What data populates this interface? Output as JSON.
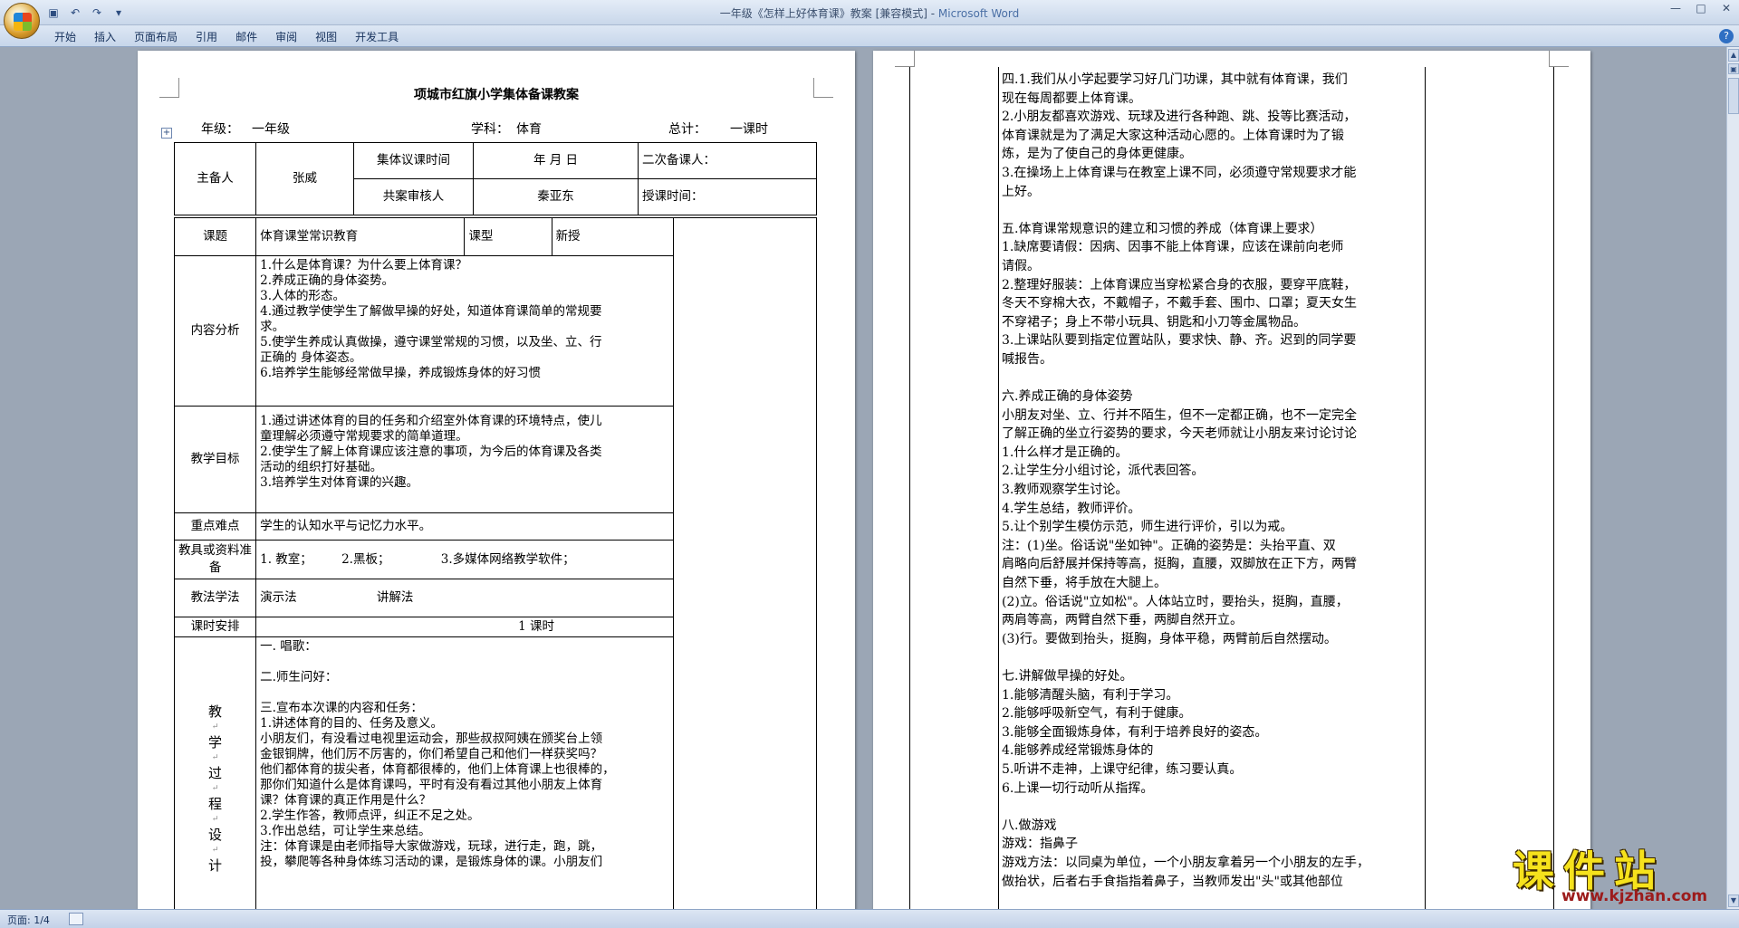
{
  "window": {
    "title": "一年级《怎样上好体育课》教案 [兼容模式] - ",
    "app_name": "Microsoft Word"
  },
  "qat": {
    "save_icon": "save-icon",
    "undo": "↶",
    "redo": "↷",
    "dropdown": "▾"
  },
  "window_controls": {
    "minimize": "—",
    "maximize": "□",
    "close": "✕"
  },
  "ribbon": {
    "tabs": [
      "开始",
      "插入",
      "页面布局",
      "引用",
      "邮件",
      "审阅",
      "视图",
      "开发工具"
    ],
    "help": "?"
  },
  "page1": {
    "title": "项城市红旗小学集体备课教案",
    "grade_label": "年级：",
    "grade": "一年级",
    "subject_label": "学科：",
    "subject": "体育",
    "total_label": "总计：",
    "total": "一课时",
    "table": {
      "host_label": "主备人",
      "host": "张威",
      "meeting_time_label": "集体议课时间",
      "meeting_time": "年    月    日",
      "second_label": "二次备课人：",
      "reviewer_label": "共案审核人",
      "reviewer": "秦亚东",
      "teach_time_label": "授课时间：",
      "topic_label": "课题",
      "topic": "体育课堂常识教育",
      "type_label": "课型",
      "type": "新授",
      "content_label": "内容分析",
      "content": [
        "1.什么是体育课？为什么要上体育课？",
        "2.养成正确的身体姿势。",
        "3.人体的形态。",
        "4.通过教学使学生了解做早操的好处，知道体育课简单的常规要",
        "求。",
        "5.使学生养成认真做操，遵守课堂常规的习惯，以及坐、立、行",
        "正确的 身体姿态。",
        "6.培养学生能够经常做早操，养成锻炼身体的好习惯"
      ],
      "goal_label": "教学目标",
      "goals": [
        "1.通过讲述体育的目的任务和介绍室外体育课的环境特点，使儿",
        "童理解必须遵守常规要求的简单道理。",
        "2.使学生了解上体育课应该注意的事项，为今后的体育课及各类",
        "活动的组织打好基础。",
        "3.培养学生对体育课的兴趣。"
      ],
      "key_label": "重点难点",
      "key": "学生的认知水平与记忆力水平。",
      "tools_label": "教具或资料准备",
      "tools": [
        "1. 教室；",
        "2.黑板；",
        "3.多媒体网络教学软件；"
      ],
      "method_label": "教法学法",
      "methods": [
        "演示法",
        "讲解法"
      ],
      "schedule_label": "课时安排",
      "schedule": "1 课时",
      "process_label": [
        "教",
        "学",
        "过",
        "程",
        "设",
        "计"
      ],
      "process": [
        "一.      唱歌：",
        "",
        "二.师生问好：",
        "",
        "三.宣布本次课的内容和任务：",
        "1.讲述体育的目的、任务及意义。",
        "小朋友们，有没看过电视里运动会，那些叔叔阿姨在颁奖台上领",
        "金银铜牌，他们厉不厉害的，你们希望自己和他们一样获奖吗？",
        "他们都体育的拔尖者，体育都很棒的，他们上体育课上也很棒的，",
        "那你们知道什么是体育课吗，平时有没有看过其他小朋友上体育",
        "课？体育课的真正作用是什么？",
        "2.学生作答，教师点评，纠正不足之处。",
        "3.作出总结，可让学生来总结。",
        "注：体育课是由老师指导大家做游戏，玩球，进行走，跑，跳，",
        "投，攀爬等各种身体练习活动的课，是锻炼身体的课。小朋友们"
      ]
    }
  },
  "page2": {
    "lines": [
      "四.1.我们从小学起要学习好几门功课，其中就有体育课，我们",
      "现在每周都要上体育课。",
      "2.小朋友都喜欢游戏、玩球及进行各种跑、跳、投等比赛活动，",
      "体育课就是为了满足大家这种活动心愿的。上体育课时为了锻",
      "炼，是为了使自己的身体更健康。",
      "3.在操场上上体育课与在教室上课不同，必须遵守常规要求才能",
      "上好。",
      "",
      "五.体育课常规意识的建立和习惯的养成（体育课上要求）",
      " 1.缺席要请假：因病、因事不能上体育课，应该在课前向老师",
      "请假。",
      "2.整理好服装：上体育课应当穿松紧合身的衣服，要穿平底鞋，",
      "冬天不穿棉大衣，不戴帽子，不戴手套、围巾、口罩；夏天女生",
      "不穿裙子；身上不带小玩具、钥匙和小刀等金属物品。",
      "3.上课站队要到指定位置站队，要求快、静、齐。迟到的同学要",
      "喊报告。",
      "",
      "六.养成正确的身体姿势",
      "小朋友对坐、立、行并不陌生，但不一定都正确，也不一定完全",
      "了解正确的坐立行姿势的要求，今天老师就让小朋友来讨论讨论",
      "1.什么样才是正确的。",
      "2.让学生分小组讨论，派代表回答。",
      "3.教师观察学生讨论。",
      "4.学生总结，教师评价。",
      "5.让个别学生模仿示范，师生进行评价，引以为戒。",
      "注：(1)坐。俗话说\"坐如钟\"。正确的姿势是：头抬平直、双",
      "肩略向后舒展并保持等高，挺胸，直腰，双脚放在正下方，两臂",
      "自然下垂，将手放在大腿上。",
      "(2)立。俗话说\"立如松\"。人体站立时，要抬头，挺胸，直腰，",
      "两肩等高，两臂自然下垂，两脚自然开立。",
      "(3)行。要做到抬头，挺胸，身体平稳，两臂前后自然摆动。",
      "",
      "七.讲解做早操的好处。",
      "1.能够清醒头脑，有利于学习。",
      "2.能够呼吸新空气，有利于健康。",
      "3.能够全面锻炼身体，有利于培养良好的姿态。",
      "4.能够养成经常锻炼身体的",
      "5.听讲不走神，上课守纪律，练习要认真。",
      "6.上课一切行动听从指挥。",
      "",
      "八.做游戏",
      "游戏：指鼻子",
      "游戏方法：以同桌为单位，一个小朋友拿着另一个小朋友的左手，",
      "做抬状，后者右手食指指着鼻子，当教师发出\"头\"或其他部位"
    ]
  },
  "status": {
    "page": "页面: 1/4"
  },
  "watermark": {
    "brand": "课件站",
    "url": "www.kjzhan.com"
  }
}
